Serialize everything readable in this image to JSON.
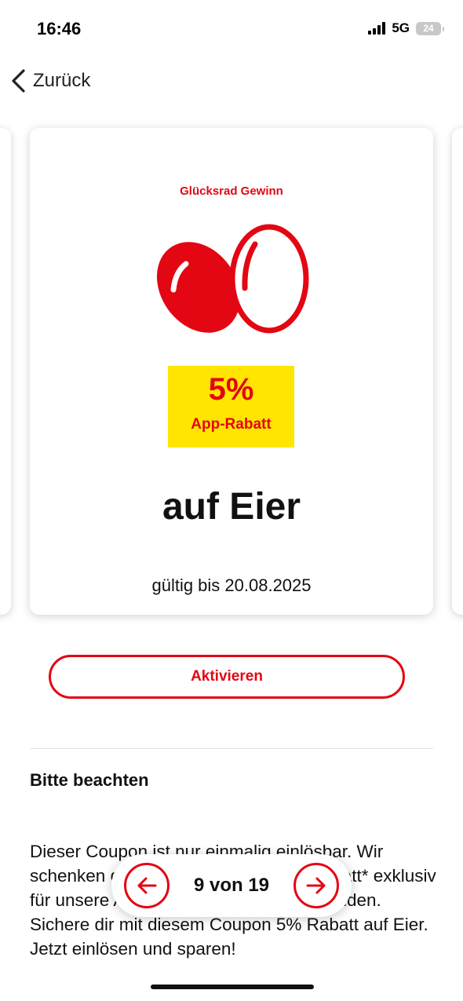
{
  "status_bar": {
    "time": "16:46",
    "network": "5G",
    "battery": "24"
  },
  "nav": {
    "back_label": "Zurück",
    "back_icon": "chevron-left-icon"
  },
  "coupon": {
    "kicker": "Glücksrad Gewinn",
    "image": "eggs-icon",
    "discount": "5%",
    "discount_label": "App-Rabatt",
    "headline": "auf Eier",
    "valid_until": "gültig bis 20.08.2025"
  },
  "actions": {
    "activate_label": "Aktivieren"
  },
  "notice": {
    "title": "Bitte beachten",
    "body": "Dieser Coupon ist nur einmalig einlösbar. Wir schenken dir einen einmaligen App-Rabatt* exklusiv für unsere App-Nutzerinnen und -Nutzenden. Sichere dir mit diesem Coupon 5% Rabatt auf Eier. Jetzt einlösen und sparen!"
  },
  "pager": {
    "label": "9 von 19",
    "prev_icon": "arrow-left-icon",
    "next_icon": "arrow-right-icon"
  },
  "colors": {
    "brand_red": "#e30613",
    "badge_yellow": "#ffe500"
  }
}
